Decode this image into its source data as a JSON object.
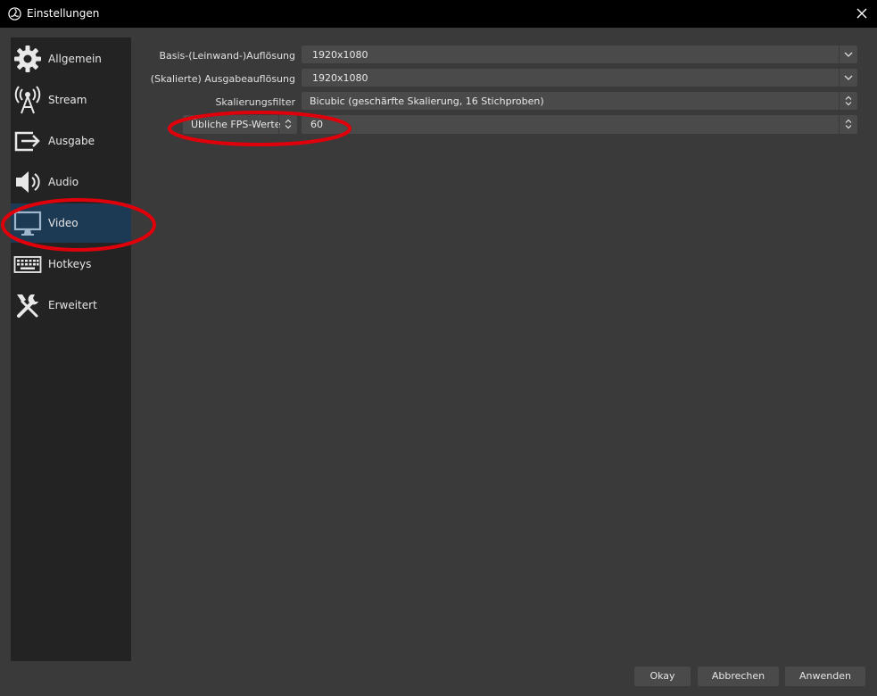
{
  "window": {
    "title": "Einstellungen"
  },
  "sidebar": {
    "items": [
      {
        "label": "Allgemein",
        "icon": "gear-icon"
      },
      {
        "label": "Stream",
        "icon": "broadcast-tower-icon"
      },
      {
        "label": "Ausgabe",
        "icon": "output-arrow-icon"
      },
      {
        "label": "Audio",
        "icon": "speaker-icon"
      },
      {
        "label": "Video",
        "icon": "monitor-icon",
        "active": true
      },
      {
        "label": "Hotkeys",
        "icon": "keyboard-icon"
      },
      {
        "label": "Erweitert",
        "icon": "tools-icon"
      }
    ]
  },
  "video": {
    "base_resolution": {
      "label": "Basis-(Leinwand-)Auflösung",
      "value": "1920x1080"
    },
    "output_resolution": {
      "label": "(Skalierte) Ausgabeauflösung",
      "value": "1920x1080"
    },
    "downscale_filter": {
      "label": "Skalierungsfilter",
      "value": "Bicubic (geschärfte Skalierung, 16 Stichproben)"
    },
    "fps": {
      "type_label": "Übliche FPS-Werte",
      "value": "60"
    }
  },
  "buttons": {
    "ok": "Okay",
    "cancel": "Abbrechen",
    "apply": "Anwenden"
  },
  "colors": {
    "highlight": "#e0000b",
    "active_item": "#1d3a55",
    "sidebar_bg": "#232323",
    "panel_bg": "#3a3a3a"
  }
}
